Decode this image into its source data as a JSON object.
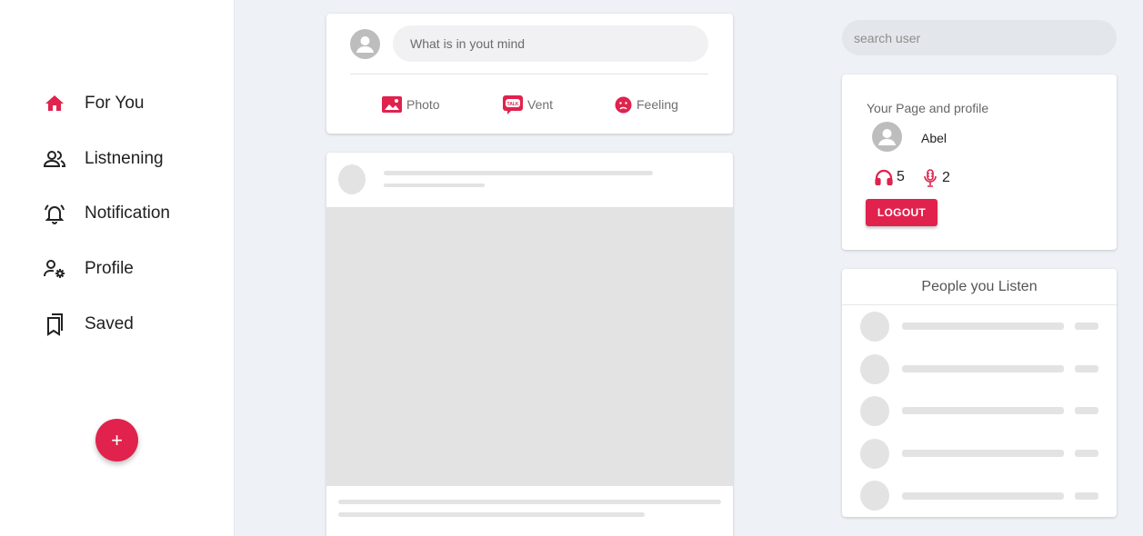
{
  "sidebar": {
    "items": [
      {
        "label": "For You",
        "icon": "home-icon",
        "active": true
      },
      {
        "label": "Listnening",
        "icon": "people-icon"
      },
      {
        "label": "Notification",
        "icon": "bell-icon"
      },
      {
        "label": "Profile",
        "icon": "person-gear-icon"
      },
      {
        "label": "Saved",
        "icon": "bookmarks-icon"
      }
    ],
    "fab_label": "+"
  },
  "composer": {
    "placeholder": "What is in yout mind",
    "actions": [
      {
        "label": "Photo",
        "icon": "image-icon"
      },
      {
        "label": "Vent",
        "icon": "talk-bubble-icon"
      },
      {
        "label": "Feeling",
        "icon": "sad-face-icon"
      }
    ]
  },
  "search": {
    "placeholder": "search user"
  },
  "profile_card": {
    "title": "Your Page and profile",
    "name": "Abel",
    "listeners_count": "5",
    "mic_count": "2",
    "logout_label": "LOGOUT"
  },
  "listen_card": {
    "title": "People you Listen"
  },
  "colors": {
    "accent": "#e0224d",
    "background": "#eef2f6",
    "skeleton": "#e3e3e3"
  }
}
